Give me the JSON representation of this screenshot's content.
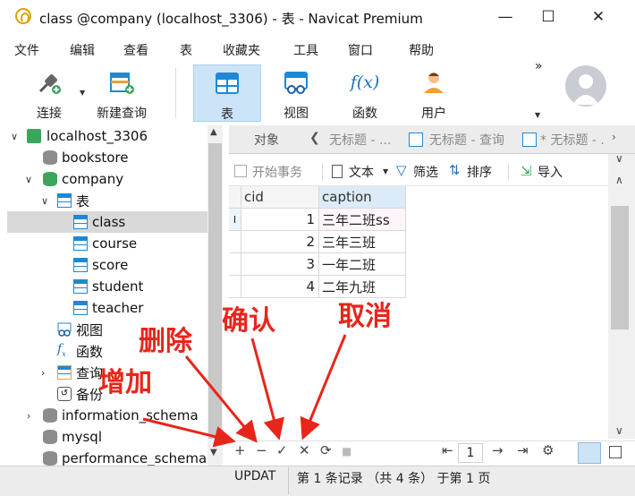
{
  "window": {
    "title": "class @company (localhost_3306) - 表 - Navicat Premium",
    "minimize": "—",
    "maximize": "☐",
    "close": "✕"
  },
  "menu": [
    "文件",
    "编辑",
    "查看",
    "表",
    "收藏夹",
    "工具",
    "窗口",
    "帮助"
  ],
  "toolbar": {
    "connect": "连接",
    "new_query": "新建查询",
    "table": "表",
    "view": "视图",
    "function": "函数",
    "user": "用户",
    "more": "»",
    "fx_glyph": "f(x)"
  },
  "tree": {
    "connection": "localhost_3306",
    "databases": [
      "bookstore",
      "company"
    ],
    "tables_label": "表",
    "tables": [
      "class",
      "course",
      "score",
      "student",
      "teacher"
    ],
    "selected_table": "class",
    "views_label": "视图",
    "functions_label": "函数",
    "queries_label": "查询",
    "backups_label": "备份",
    "other_dbs": [
      "information_schema",
      "mysql",
      "performance_schema"
    ]
  },
  "tabs": {
    "objects": "对象",
    "tab1": "无标题 - ...",
    "tab2": "无标题 - 查询",
    "tab3": "* 无标题 - ..."
  },
  "grid_toolbar": {
    "begin_txn": "开始事务",
    "text": "文本",
    "filter": "筛选",
    "sort": "排序",
    "import": "导入"
  },
  "grid": {
    "columns": [
      "cid",
      "caption"
    ],
    "rows": [
      {
        "cid": "1",
        "caption": "三年二班ss"
      },
      {
        "cid": "2",
        "caption": "三年三班"
      },
      {
        "cid": "3",
        "caption": "一年二班"
      },
      {
        "cid": "4",
        "caption": "二年九班"
      }
    ]
  },
  "nav": {
    "add": "+",
    "delete": "−",
    "confirm": "✓",
    "cancel": "✕",
    "refresh": "⟳",
    "stop": "■",
    "first": "⇤",
    "prev": "←",
    "page": "1",
    "next": "→",
    "last": "⇥",
    "settings": "⚙"
  },
  "status": {
    "mode": "UPDAT",
    "record_info": "第 1 条记录 （共 4 条） 于第 1 页"
  },
  "annotations": {
    "add": "增加",
    "delete": "删除",
    "confirm": "确认",
    "cancel": "取消"
  },
  "colors": {
    "annotation": "#e8251a",
    "accent": "#1e88d4",
    "selected_tab_bg": "#cce4f7"
  }
}
